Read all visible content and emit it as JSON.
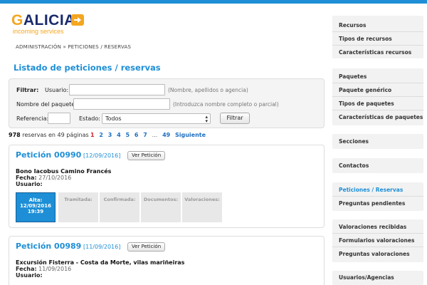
{
  "brand": {
    "logo_main_initial": "G",
    "logo_main_rest": "ALICIA",
    "logo_sub": "incoming services",
    "logo_icon": "arrow-right-icon",
    "accent_color": "#1e8fd6",
    "logo_color": "#f4a620"
  },
  "breadcrumb": "ADMINISTRACIÓN » PETICIONES / RESERVAS",
  "page_title": "Listado de peticiones / reservas",
  "filter": {
    "heading": "Filtrar:",
    "user_label": "Usuario:",
    "user_value": "",
    "user_hint": "(Nombre, apellidos o agencia)",
    "package_label": "Nombre del paquete:",
    "package_value": "",
    "package_hint": "(Introduzca nombre completo o parcial)",
    "reference_label": "Referencia:",
    "reference_value": "",
    "state_label": "Estado:",
    "state_selected": "Todos",
    "submit_label": "Filtrar"
  },
  "summary": {
    "count": "978",
    "text": "reservas en 49 páginas"
  },
  "pager": {
    "current": "1",
    "pages": [
      "2",
      "3",
      "4",
      "5",
      "6",
      "7"
    ],
    "dots": "...",
    "last": "49",
    "next": "Siguiente"
  },
  "requests": [
    {
      "title": "Petición 00990",
      "date": "[12/09/2016]",
      "view_label": "Ver Petición",
      "product": "Bono Iacobus Camino Francés",
      "fecha_label": "Fecha:",
      "fecha_value": "27/10/2016",
      "usuario_label": "Usuario:",
      "usuario_value": "",
      "steps": [
        {
          "label": "Alta:",
          "date": "12/09/2016",
          "time": "19:39",
          "active": true
        },
        {
          "label": "Tramitada:",
          "active": false
        },
        {
          "label": "Confirmada:",
          "active": false
        },
        {
          "label": "Documentos:",
          "active": false
        },
        {
          "label": "Valoraciones:",
          "active": false
        }
      ]
    },
    {
      "title": "Petición 00989",
      "date": "[11/09/2016]",
      "view_label": "Ver Petición",
      "product": "Excursión Fisterra - Costa da Morte, vilas mariñeiras",
      "fecha_label": "Fecha:",
      "fecha_value": "11/09/2016",
      "usuario_label": "Usuario:",
      "usuario_value": ""
    }
  ],
  "sidebar": {
    "groups": [
      {
        "items": [
          "Recursos",
          "Tipos de recursos",
          "Características recursos"
        ]
      },
      {
        "items": [
          "Paquetes",
          "Paquete genérico",
          "Tipos de paquetes",
          "Características de paquetes"
        ]
      },
      {
        "items": [
          "Secciones"
        ]
      },
      {
        "items": [
          "Contactos"
        ]
      },
      {
        "items": [
          "Peticiones / Reservas",
          "Preguntas pendientes"
        ]
      },
      {
        "items": [
          "Valoraciones recibidas",
          "Formularios valoraciones",
          "Preguntas valoraciones"
        ]
      },
      {
        "items": [
          "Usuarios/Agencias"
        ]
      }
    ],
    "active_item": "Peticiones / Reservas"
  }
}
